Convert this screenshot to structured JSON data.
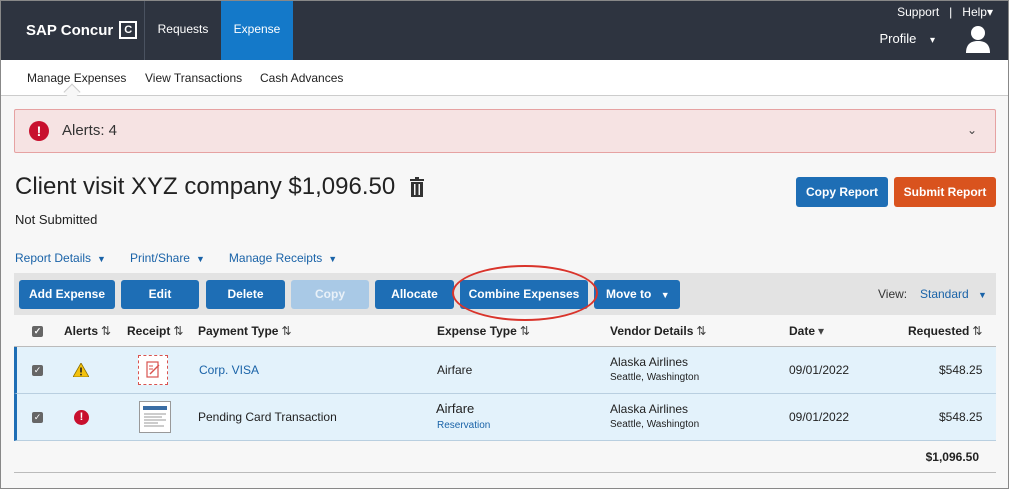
{
  "topbar": {
    "brand": "SAP Concur",
    "brand_mark": "C",
    "nav": [
      {
        "label": "Requests"
      },
      {
        "label": "Expense"
      }
    ],
    "support": "Support",
    "separator": "|",
    "help": "Help",
    "help_caret": "▾",
    "profile": "Profile",
    "profile_caret": "▾"
  },
  "subnav": {
    "items": [
      {
        "label": "Manage Expenses"
      },
      {
        "label": "View Transactions"
      },
      {
        "label": "Cash Advances"
      }
    ]
  },
  "alert": {
    "icon": "!",
    "text": "Alerts: 4",
    "chevron": "⌄"
  },
  "report": {
    "title": "Client visit XYZ company $1,096.50",
    "status": "Not Submitted",
    "copy_button": "Copy Report",
    "submit_button": "Submit Report",
    "links": [
      {
        "label": "Report Details"
      },
      {
        "label": "Print/Share"
      },
      {
        "label": "Manage Receipts"
      }
    ]
  },
  "toolbar": {
    "add_expense": "Add Expense",
    "edit": "Edit",
    "delete": "Delete",
    "copy": "Copy",
    "allocate": "Allocate",
    "combine": "Combine Expenses",
    "move_to": "Move to",
    "view_label": "View:",
    "view_value": "Standard"
  },
  "table": {
    "headers": {
      "alerts": "Alerts",
      "receipt": "Receipt",
      "payment_type": "Payment Type",
      "expense_type": "Expense Type",
      "vendor": "Vendor Details",
      "date": "Date",
      "requested": "Requested"
    },
    "sort_glyph": "⇅",
    "filter_glyph": "▾",
    "rows": [
      {
        "alert_icon": "warning-icon",
        "payment_type": "Corp. VISA",
        "expense_type": "Airfare",
        "expense_sub": "",
        "vendor": "Alaska Airlines",
        "vendor_location": "Seattle, Washington",
        "date": "09/01/2022",
        "requested": "$548.25"
      },
      {
        "alert_icon": "error-icon",
        "alert_glyph": "!",
        "payment_type": "Pending Card Transaction",
        "expense_type": "Airfare",
        "expense_sub": "Reservation",
        "vendor": "Alaska Airlines",
        "vendor_location": "Seattle, Washington",
        "date": "09/01/2022",
        "requested": "$548.25"
      }
    ],
    "total": "$1,096.50"
  },
  "colors": {
    "topbar": "#2e3440",
    "primary": "#1e6eb5",
    "submit": "#d9531e",
    "alert_bg": "#f6e3e3",
    "error": "#c8102e",
    "highlight": "#d9342b"
  }
}
